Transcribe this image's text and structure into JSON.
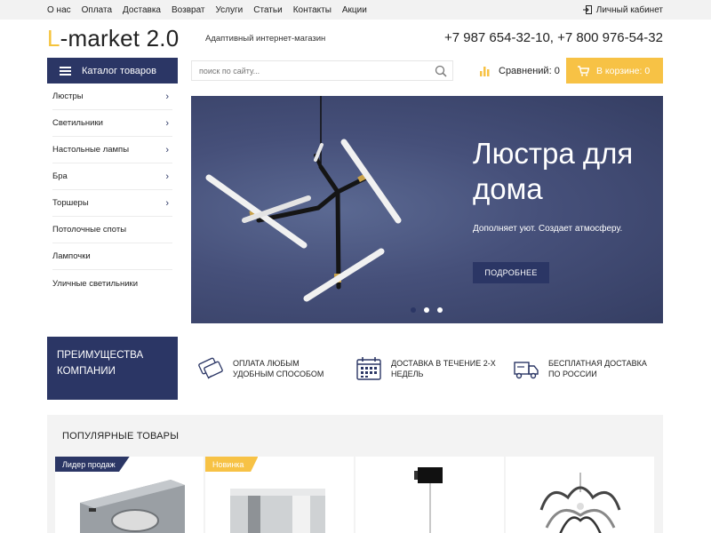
{
  "topnav": [
    "О нас",
    "Оплата",
    "Доставка",
    "Возврат",
    "Услуги",
    "Статьи",
    "Контакты",
    "Акции"
  ],
  "account_label": "Личный кабинет",
  "logo": {
    "letter": "L",
    "rest": "-market 2.0"
  },
  "tagline": "Адаптивный интернет-магазин",
  "phones": "+7 987 654-32-10, +7 800 976-54-32",
  "catalog_label": "Каталог товаров",
  "search_placeholder": "поиск по сайту...",
  "compare_label": "Сравнений: 0",
  "cart_label": "В корзине: 0",
  "sidebar": [
    {
      "label": "Люстры",
      "arrow": true
    },
    {
      "label": "Светильники",
      "arrow": true
    },
    {
      "label": "Настольные лампы",
      "arrow": true
    },
    {
      "label": "Бра",
      "arrow": true
    },
    {
      "label": "Торшеры",
      "arrow": true
    },
    {
      "label": "Потолочные споты",
      "arrow": false
    },
    {
      "label": "Лампочки",
      "arrow": false
    },
    {
      "label": "Уличные светильники",
      "arrow": false
    }
  ],
  "banner": {
    "title": "Люстра для дома",
    "subtitle": "Дополняет уют. Создает атмосферу.",
    "button": "ПОДРОБНЕЕ",
    "slides": 3,
    "active_slide": 0
  },
  "advantages": {
    "heading": "ПРЕИМУЩЕСТВА КОМПАНИИ",
    "items": [
      {
        "icon": "credit-card-icon",
        "text": "ОПЛАТА ЛЮБЫМ УДОБНЫМ СПОСОБОМ"
      },
      {
        "icon": "calendar-icon",
        "text": "ДОСТАВКА В ТЕЧЕНИЕ 2-Х НЕДЕЛЬ"
      },
      {
        "icon": "truck-icon",
        "text": "БЕСПЛАТНАЯ ДОСТАВКА ПО РОССИИ"
      }
    ]
  },
  "popular": {
    "title": "ПОПУЛЯРНЫЕ ТОВАРЫ",
    "cards": [
      {
        "badge": "Лидер продаж",
        "badge_style": "dark"
      },
      {
        "badge": "Новинка",
        "badge_style": "yellow"
      },
      {
        "badge": "",
        "badge_style": ""
      },
      {
        "badge": "",
        "badge_style": ""
      }
    ]
  },
  "colors": {
    "accent": "#2b3665",
    "brand_yellow": "#f7c245",
    "banner_bg": "#46507a"
  }
}
